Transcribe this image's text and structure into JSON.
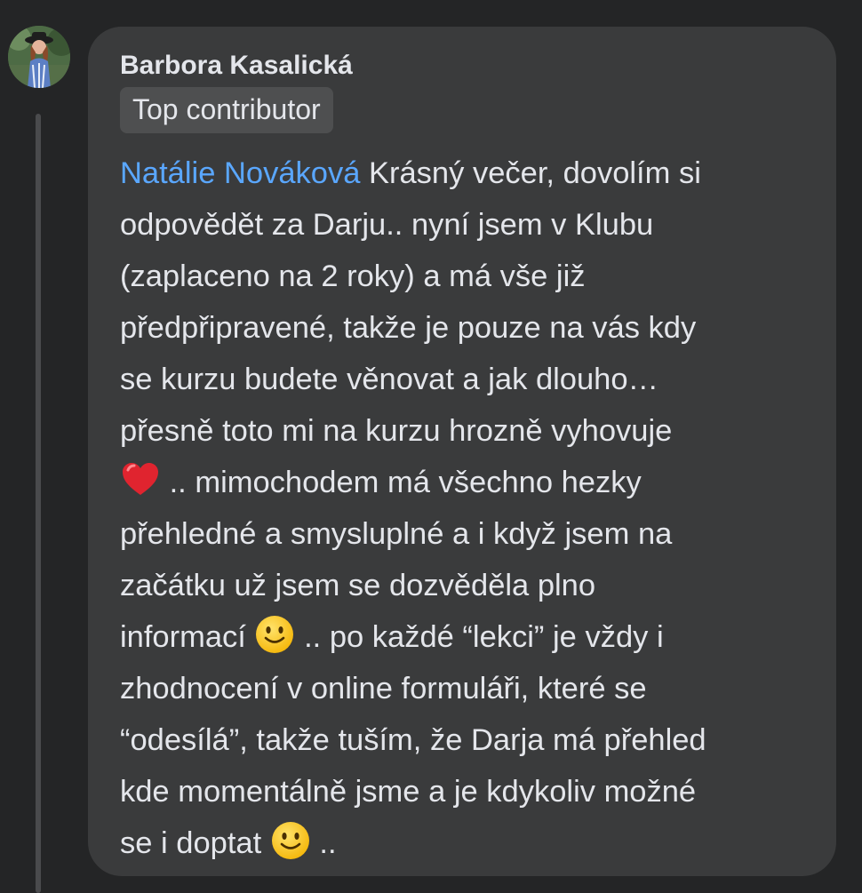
{
  "comment": {
    "author": "Barbora Kasalická",
    "badge": "Top contributor",
    "mention": "Natálie Nováková",
    "lines": [
      "Krásný večer, dovolím si",
      "odpovědět za Darju.. nyní jsem v Klubu",
      "(zaplaceno na 2 roky) a má vše již",
      "předpřipravené, takže je pouze na vás kdy",
      "se kurzu budete věnovat a jak dlouho…",
      "přesně toto mi na kurzu hrozně vyhovuje",
      ".. mimochodem má všechno hezky",
      "přehledné a smysluplné a i když jsem na",
      "začátku už jsem se dozvěděla plno",
      "informací",
      ".. po každé “lekci” je vždy i",
      "zhodnocení v online formuláři, které se",
      "“odesílá”, takže tuším, že Darja má přehled",
      "kde momentálně jsme a je kdykoliv možné",
      "se i doptat",
      ".."
    ],
    "emojis": [
      "red-heart",
      "slightly-smiling-face",
      "slightly-smiling-face"
    ]
  },
  "colors": {
    "background": "#242526",
    "bubble": "#3a3b3c",
    "text": "#e4e6eb",
    "mention": "#5aa7ff",
    "badge_bg": "#4e4f50"
  }
}
